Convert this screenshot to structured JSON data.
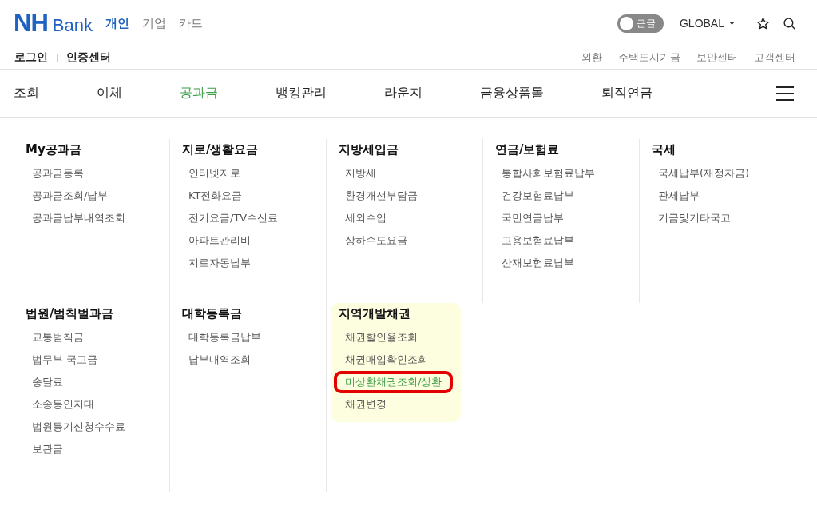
{
  "logo": {
    "mark": "NH",
    "word": "Bank"
  },
  "segments": [
    {
      "label": "개인",
      "selected": true
    },
    {
      "label": "기업",
      "selected": false
    },
    {
      "label": "카드",
      "selected": false
    }
  ],
  "font_toggle": {
    "label": "큰글",
    "on": false
  },
  "global_menu": {
    "label": "GLOBAL"
  },
  "account_links": [
    "로그인",
    "인증센터"
  ],
  "utility_links": [
    "외환",
    "주택도시기금",
    "보안센터",
    "고객센터"
  ],
  "nav": [
    {
      "label": "조회",
      "selected": false
    },
    {
      "label": "이체",
      "selected": false
    },
    {
      "label": "공과금",
      "selected": true
    },
    {
      "label": "뱅킹관리",
      "selected": false
    },
    {
      "label": "라운지",
      "selected": false
    },
    {
      "label": "금융상품몰",
      "selected": false
    },
    {
      "label": "퇴직연금",
      "selected": false
    }
  ],
  "mega_menu": {
    "rows": [
      [
        {
          "title": "My공과금",
          "highlighted": false,
          "items": [
            {
              "label": "공과금등록",
              "selected": false
            },
            {
              "label": "공과금조회/납부",
              "selected": false
            },
            {
              "label": "공과금납부내역조회",
              "selected": false
            }
          ]
        },
        {
          "title": "지로/생활요금",
          "highlighted": false,
          "items": [
            {
              "label": "인터넷지로",
              "selected": false
            },
            {
              "label": "KT전화요금",
              "selected": false
            },
            {
              "label": "전기요금/TV수신료",
              "selected": false
            },
            {
              "label": "아파트관리비",
              "selected": false
            },
            {
              "label": "지로자동납부",
              "selected": false
            }
          ]
        },
        {
          "title": "지방세입금",
          "highlighted": false,
          "items": [
            {
              "label": "지방세",
              "selected": false
            },
            {
              "label": "환경개선부담금",
              "selected": false
            },
            {
              "label": "세외수입",
              "selected": false
            },
            {
              "label": "상하수도요금",
              "selected": false
            }
          ]
        },
        {
          "title": "연금/보험료",
          "highlighted": false,
          "items": [
            {
              "label": "통합사회보험료납부",
              "selected": false
            },
            {
              "label": "건강보험료납부",
              "selected": false
            },
            {
              "label": "국민연금납부",
              "selected": false
            },
            {
              "label": "고용보험료납부",
              "selected": false
            },
            {
              "label": "산재보험료납부",
              "selected": false
            }
          ]
        },
        {
          "title": "국세",
          "highlighted": false,
          "items": [
            {
              "label": "국세납부(재정자금)",
              "selected": false
            },
            {
              "label": "관세납부",
              "selected": false
            },
            {
              "label": "기금및기타국고",
              "selected": false
            }
          ]
        }
      ],
      [
        {
          "title": "법원/범칙벌과금",
          "highlighted": false,
          "items": [
            {
              "label": "교통범칙금",
              "selected": false
            },
            {
              "label": "법무부 국고금",
              "selected": false
            },
            {
              "label": "송달료",
              "selected": false
            },
            {
              "label": "소송등인지대",
              "selected": false
            },
            {
              "label": "법원등기신청수수료",
              "selected": false
            },
            {
              "label": "보관금",
              "selected": false
            }
          ]
        },
        {
          "title": "대학등록금",
          "highlighted": false,
          "items": [
            {
              "label": "대학등록금납부",
              "selected": false
            },
            {
              "label": "납부내역조회",
              "selected": false
            }
          ]
        },
        {
          "title": "지역개발채권",
          "highlighted": true,
          "items": [
            {
              "label": "채권할인율조회",
              "selected": false
            },
            {
              "label": "채권매입확인조회",
              "selected": false
            },
            {
              "label": "미상환채권조회/상환",
              "selected": true
            },
            {
              "label": "채권변경",
              "selected": false
            }
          ]
        }
      ]
    ]
  }
}
